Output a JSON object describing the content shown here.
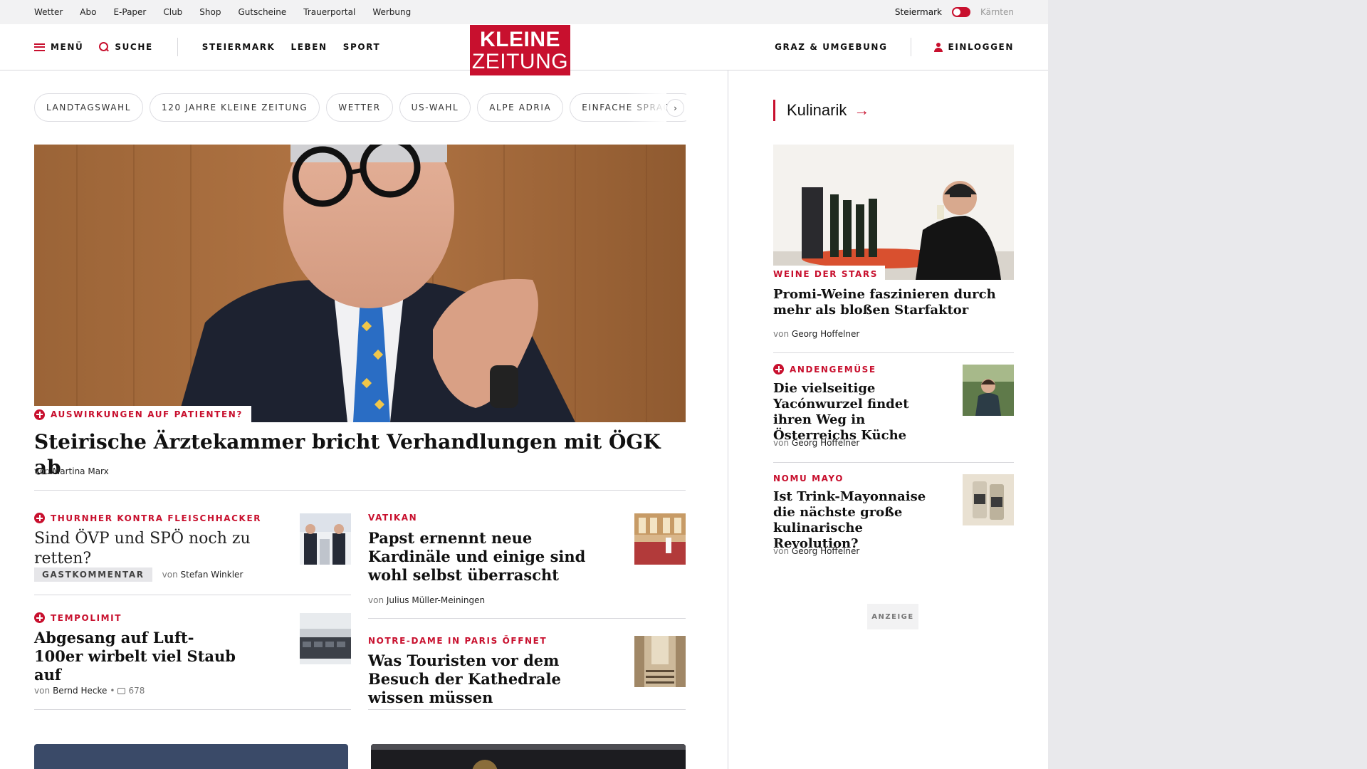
{
  "utility_bar": {
    "links": [
      "Wetter",
      "Abo",
      "E-Paper",
      "Club",
      "Shop",
      "Gutscheine",
      "Trauerportal",
      "Werbung"
    ],
    "region_active": "Steiermark",
    "region_inactive": "Kärnten"
  },
  "header": {
    "menu_label": "MENÜ",
    "search_label": "SUCHE",
    "nav": [
      "STEIERMARK",
      "LEBEN",
      "SPORT"
    ],
    "logo_line1": "KLEINE",
    "logo_line2": "ZEITUNG",
    "region_link": "GRAZ & UMGEBUNG",
    "login_label": "EINLOGGEN"
  },
  "chips": [
    "LANDTAGSWAHL",
    "120 JAHRE KLEINE ZEITUNG",
    "WETTER",
    "US-WAHL",
    "ALPE ADRIA",
    "EINFACHE SPRACHE"
  ],
  "hero": {
    "kicker": "AUSWIRKUNGEN AUF PATIENTEN?",
    "title": "Steirische Ärztekammer bricht Verhandlungen mit ÖGK ab",
    "von": "von",
    "author": "Martina Marx"
  },
  "articles": [
    {
      "kicker": "THURNHER KONTRA FLEISCHHACKER",
      "title": "Sind ÖVP und SPÖ noch zu retten?",
      "badge": "GASTKOMMENTAR",
      "von": "von",
      "author": "Stefan Winkler"
    },
    {
      "kicker": "VATIKAN",
      "title": "Papst ernennt neue Kardinäle und einige sind wohl selbst überrascht",
      "von": "von",
      "author": "Julius Müller-Meiningen"
    },
    {
      "kicker": "TEMPOLIMIT",
      "title": "Abgesang auf Luft-100er wirbelt viel Staub auf",
      "von": "von",
      "author": "Bernd Hecke",
      "separator": "•",
      "comments": "678"
    },
    {
      "kicker": "NOTRE-DAME IN PARIS ÖFFNET",
      "title": "Was Touristen vor dem Besuch der Kathedrale wissen müssen"
    }
  ],
  "sidebar": {
    "section_title": "Kulinarik",
    "items": [
      {
        "kicker": "WEINE DER STARS",
        "title": "Promi-Weine faszinieren durch mehr als bloßen Starfaktor",
        "von": "von",
        "author": "Georg Hoffelner"
      },
      {
        "kicker": "ANDENGEMÜSE",
        "title": "Die vielseitige Yacónwurzel findet ihren Weg in Österreichs Küche",
        "von": "von",
        "author": "Georg Hoffelner"
      },
      {
        "kicker": "NOMU MAYO",
        "title": "Ist Trink-Mayonnaise die nächste große kulinarische Revolution?",
        "von": "von",
        "author": "Georg Hoffelner"
      }
    ],
    "ad_label": "ANZEIGE"
  },
  "colors": {
    "brand_red": "#c8102e",
    "text": "#111111",
    "divider": "#d8d8dc",
    "utility_bg": "#f2f2f3"
  }
}
